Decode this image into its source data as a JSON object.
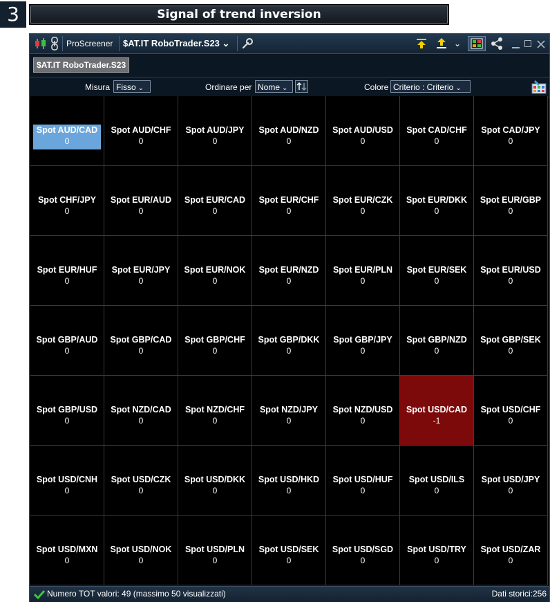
{
  "step_number": "3",
  "banner_title": "Signal of trend inversion",
  "window": {
    "app_name": "ProScreener",
    "screener_name": "$AT.IT RoboTrader.S23",
    "symbol_chip": "$AT.IT RoboTrader.S23",
    "icons": [
      "candles-icon",
      "link-chain-icon",
      "wrench-icon",
      "download-icon",
      "upload-icon",
      "chevron-down-icon",
      "grid-view-icon",
      "share-icon",
      "minimize-icon",
      "maximize-icon",
      "close-icon",
      "palette-icon",
      "sort-direction-icon",
      "check-icon"
    ]
  },
  "options": {
    "size_label": "Misura",
    "size_value": "Fisso",
    "sort_label": "Ordinare per",
    "sort_value": "Nome",
    "color_label": "Colore",
    "color_value": "Criterio : Criterio"
  },
  "colors": {
    "selected_cell": "#6aa6dc",
    "alert_cell": "#7d0a0a",
    "cell_background": "#000000"
  },
  "cells": [
    {
      "name": "Spot AUD/CAD",
      "value": "0"
    },
    {
      "name": "Spot AUD/CHF",
      "value": "0"
    },
    {
      "name": "Spot AUD/JPY",
      "value": "0"
    },
    {
      "name": "Spot AUD/NZD",
      "value": "0"
    },
    {
      "name": "Spot AUD/USD",
      "value": "0"
    },
    {
      "name": "Spot CAD/CHF",
      "value": "0"
    },
    {
      "name": "Spot CAD/JPY",
      "value": "0"
    },
    {
      "name": "Spot CHF/JPY",
      "value": "0"
    },
    {
      "name": "Spot EUR/AUD",
      "value": "0"
    },
    {
      "name": "Spot EUR/CAD",
      "value": "0"
    },
    {
      "name": "Spot EUR/CHF",
      "value": "0"
    },
    {
      "name": "Spot EUR/CZK",
      "value": "0"
    },
    {
      "name": "Spot EUR/DKK",
      "value": "0"
    },
    {
      "name": "Spot EUR/GBP",
      "value": "0"
    },
    {
      "name": "Spot EUR/HUF",
      "value": "0"
    },
    {
      "name": "Spot EUR/JPY",
      "value": "0"
    },
    {
      "name": "Spot EUR/NOK",
      "value": "0"
    },
    {
      "name": "Spot EUR/NZD",
      "value": "0"
    },
    {
      "name": "Spot EUR/PLN",
      "value": "0"
    },
    {
      "name": "Spot EUR/SEK",
      "value": "0"
    },
    {
      "name": "Spot EUR/USD",
      "value": "0"
    },
    {
      "name": "Spot GBP/AUD",
      "value": "0"
    },
    {
      "name": "Spot GBP/CAD",
      "value": "0"
    },
    {
      "name": "Spot GBP/CHF",
      "value": "0"
    },
    {
      "name": "Spot GBP/DKK",
      "value": "0"
    },
    {
      "name": "Spot GBP/JPY",
      "value": "0"
    },
    {
      "name": "Spot GBP/NZD",
      "value": "0"
    },
    {
      "name": "Spot GBP/SEK",
      "value": "0"
    },
    {
      "name": "Spot GBP/USD",
      "value": "0"
    },
    {
      "name": "Spot NZD/CAD",
      "value": "0"
    },
    {
      "name": "Spot NZD/CHF",
      "value": "0"
    },
    {
      "name": "Spot NZD/JPY",
      "value": "0"
    },
    {
      "name": "Spot NZD/USD",
      "value": "0"
    },
    {
      "name": "Spot USD/CAD",
      "value": "-1"
    },
    {
      "name": "Spot USD/CHF",
      "value": "0"
    },
    {
      "name": "Spot USD/CNH",
      "value": "0"
    },
    {
      "name": "Spot USD/CZK",
      "value": "0"
    },
    {
      "name": "Spot USD/DKK",
      "value": "0"
    },
    {
      "name": "Spot USD/HKD",
      "value": "0"
    },
    {
      "name": "Spot USD/HUF",
      "value": "0"
    },
    {
      "name": "Spot USD/ILS",
      "value": "0"
    },
    {
      "name": "Spot USD/JPY",
      "value": "0"
    },
    {
      "name": "Spot USD/MXN",
      "value": "0"
    },
    {
      "name": "Spot USD/NOK",
      "value": "0"
    },
    {
      "name": "Spot USD/PLN",
      "value": "0"
    },
    {
      "name": "Spot USD/SEK",
      "value": "0"
    },
    {
      "name": "Spot USD/SGD",
      "value": "0"
    },
    {
      "name": "Spot USD/TRY",
      "value": "0"
    },
    {
      "name": "Spot USD/ZAR",
      "value": "0"
    }
  ],
  "selected_cell": "Spot AUD/CAD",
  "alert_cell": "Spot USD/CAD",
  "status": {
    "left_text": "Numero TOT valori: 49 (massimo 50 visualizzati)",
    "right_text": "Dati storici:256"
  }
}
